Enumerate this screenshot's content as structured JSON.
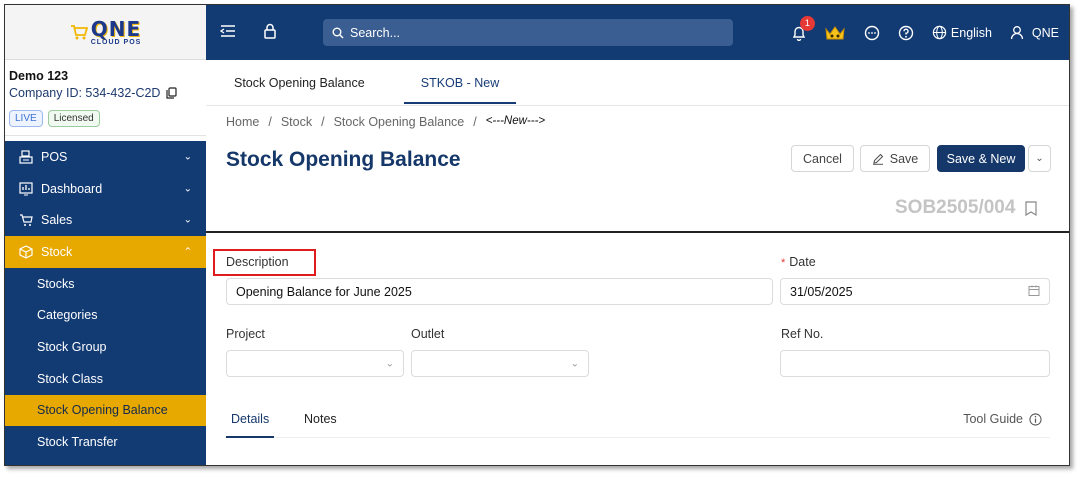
{
  "logo": {
    "brand": "QNE",
    "sub": "CLOUD POS"
  },
  "company": {
    "name": "Demo 123",
    "id_label": "Company ID: 534-432-C2D",
    "badges": [
      "LIVE",
      "Licensed"
    ]
  },
  "menu": {
    "items": [
      {
        "label": "POS",
        "icon": "pos-icon",
        "state": "collapsed"
      },
      {
        "label": "Dashboard",
        "icon": "dashboard-icon",
        "state": "collapsed"
      },
      {
        "label": "Sales",
        "icon": "cart-icon",
        "state": "collapsed"
      },
      {
        "label": "Stock",
        "icon": "box-icon",
        "state": "expanded"
      }
    ],
    "stock_children": [
      "Stocks",
      "Categories",
      "Stock Group",
      "Stock Class",
      "Stock Opening Balance",
      "Stock Transfer"
    ],
    "active_child": "Stock Opening Balance"
  },
  "topbar": {
    "search_placeholder": "Search...",
    "notification_count": "1",
    "language": "English",
    "user": "QNE"
  },
  "tabs": {
    "list_tab": "Stock Opening Balance",
    "new_tab": "STKOB - New"
  },
  "breadcrumb": [
    "Home",
    "/",
    "Stock",
    "/",
    "Stock Opening Balance",
    "/",
    "<---New--->"
  ],
  "header": {
    "title": "Stock Opening Balance",
    "cancel": "Cancel",
    "save": "Save",
    "save_new": "Save & New",
    "doc_no": "SOB2505/004"
  },
  "form": {
    "description_label": "Description",
    "description_value": "Opening Balance for June 2025",
    "date_label": "Date",
    "date_required_mark": "*",
    "date_value": "31/05/2025",
    "project_label": "Project",
    "project_value": "",
    "outlet_label": "Outlet",
    "outlet_value": "",
    "ref_label": "Ref No.",
    "ref_value": ""
  },
  "subtabs": {
    "details": "Details",
    "notes": "Notes",
    "tool_guide": "Tool Guide"
  },
  "colors": {
    "navy": "#123a73",
    "accent": "#e7a800",
    "highlight": "#e01b1b"
  }
}
